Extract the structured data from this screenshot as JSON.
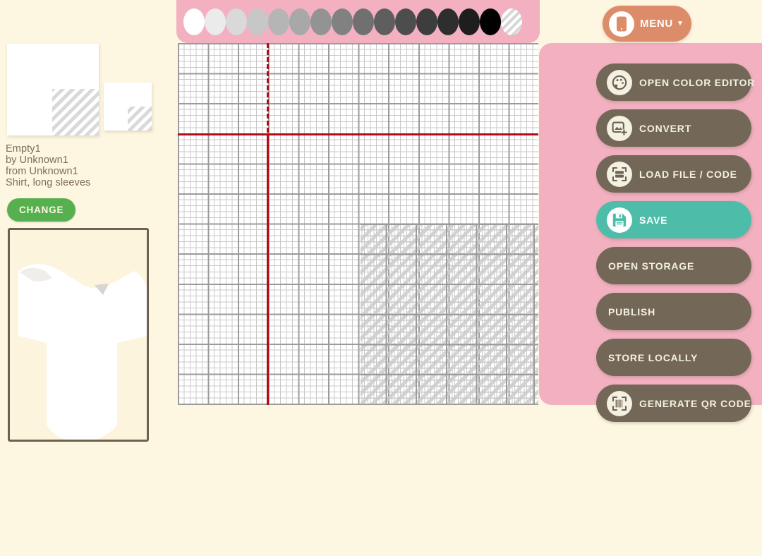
{
  "app": {
    "background_color": "#fdf6e0",
    "panel_color": "#f2b0c0"
  },
  "garment": {
    "name": "Empty1",
    "author": "by Unknown1",
    "source": "from Unknown1",
    "type": "Shirt, long sleeves",
    "change_label": "CHANGE",
    "change_color": "#57b04f"
  },
  "palette": {
    "swatches": [
      {
        "name": "white",
        "color": "#ffffff"
      },
      {
        "name": "gray-1",
        "color": "#ebebeb"
      },
      {
        "name": "gray-2",
        "color": "#d9d9d9"
      },
      {
        "name": "gray-3",
        "color": "#c7c7c7"
      },
      {
        "name": "gray-4",
        "color": "#b5b5b5"
      },
      {
        "name": "gray-5",
        "color": "#a8a8a8"
      },
      {
        "name": "gray-6",
        "color": "#939393"
      },
      {
        "name": "gray-7",
        "color": "#818181"
      },
      {
        "name": "gray-8",
        "color": "#707070"
      },
      {
        "name": "gray-9",
        "color": "#5e5e5e"
      },
      {
        "name": "gray-10",
        "color": "#4d4d4d"
      },
      {
        "name": "gray-11",
        "color": "#3d3d3d"
      },
      {
        "name": "gray-12",
        "color": "#2e2e2e"
      },
      {
        "name": "gray-13",
        "color": "#1e1e1e"
      },
      {
        "name": "black",
        "color": "#000000"
      },
      {
        "name": "transparent",
        "color": "alpha"
      }
    ]
  },
  "tools": {
    "items": [
      {
        "name": "pencil-tool",
        "icon": "pencil-icon",
        "active": true
      },
      {
        "name": "fill-tool",
        "icon": "paint-bucket-icon",
        "active": false
      },
      {
        "name": "eyedropper-tool",
        "icon": "eyedropper-icon",
        "active": false
      }
    ],
    "active_color": "#4dbdaa"
  },
  "menu": {
    "label": "MENU",
    "caret": "▼",
    "icon": "mobile-device-icon",
    "color": "#dd8c69"
  },
  "panel": {
    "buttons": [
      {
        "label": "OPEN COLOR EDITOR",
        "icon": "palette-icon",
        "highlight": false
      },
      {
        "label": "CONVERT",
        "icon": "convert-icon",
        "highlight": false
      },
      {
        "label": "LOAD FILE / CODE",
        "icon": "load-file-icon",
        "highlight": false
      },
      {
        "label": "SAVE",
        "icon": "floppy-disk-icon",
        "highlight": true
      },
      {
        "label": "OPEN STORAGE",
        "icon": null,
        "highlight": false
      },
      {
        "label": "PUBLISH",
        "icon": null,
        "highlight": false
      },
      {
        "label": "STORE LOCALLY",
        "icon": null,
        "highlight": false
      },
      {
        "label": "GENERATE QR CODE",
        "icon": "qr-code-icon",
        "highlight": false
      }
    ]
  },
  "canvas": {
    "grid_minor_color": "#c9c9c9",
    "grid_major_color": "#9b9b9b",
    "guide_color": "#b00d18",
    "cell_size_px": 8.52,
    "major_every": 5
  }
}
